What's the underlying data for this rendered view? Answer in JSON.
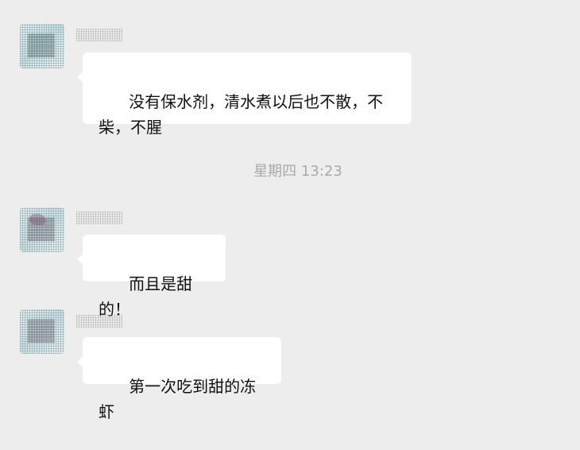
{
  "messages": [
    {
      "text": "没有保水剂，清水煮以后也不散，不柴，不腥"
    },
    {
      "text": "而且是甜的！"
    },
    {
      "text": "第一次吃到甜的冻虾"
    }
  ],
  "timestamp": "星期四 13:23"
}
